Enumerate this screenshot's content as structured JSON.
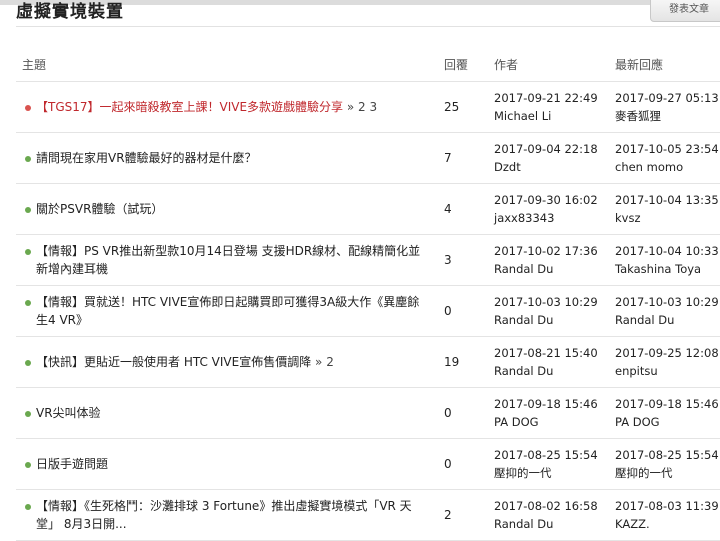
{
  "header": {
    "title": "虛擬實境裝置",
    "post_button": "發表文章"
  },
  "columns": {
    "topic": "主題",
    "replies": "回覆",
    "author": "作者",
    "last_reply": "最新回應"
  },
  "colors": {
    "hot_title": "#c0282d",
    "hot_dot": "#d9534f",
    "normal_dot": "#6aa84f"
  },
  "topics": [
    {
      "title": "【TGS17】一起來暗殺教室上課！VIVE多款遊戲體驗分享",
      "pages": "» 2 3",
      "hot": true,
      "replies": "25",
      "author_date": "2017-09-21 22:49",
      "author": "Michael Li",
      "last_date": "2017-09-27 05:13",
      "last_user": "麥香狐狸"
    },
    {
      "title": "請問現在家用VR體驗最好的器材是什麼？",
      "pages": "",
      "hot": false,
      "replies": "7",
      "author_date": "2017-09-04 22:18",
      "author": "Dzdt",
      "last_date": "2017-10-05 23:54",
      "last_user": "chen momo"
    },
    {
      "title": "關於PSVR體驗（試玩）",
      "pages": "",
      "hot": false,
      "replies": "4",
      "author_date": "2017-09-30 16:02",
      "author": "jaxx83343",
      "last_date": "2017-10-04 13:35",
      "last_user": "kvsz"
    },
    {
      "title": "【情報】PS VR推出新型款10月14日登場 支援HDR線材、配線精簡化並新增內建耳機",
      "pages": "",
      "hot": false,
      "replies": "3",
      "author_date": "2017-10-02 17:36",
      "author": "Randal Du",
      "last_date": "2017-10-04 10:33",
      "last_user": "Takashina Toya"
    },
    {
      "title": "【情報】買就送！HTC VIVE宣佈即日起購買即可獲得3A級大作《異塵餘生4 VR》",
      "pages": "",
      "hot": false,
      "replies": "0",
      "author_date": "2017-10-03 10:29",
      "author": "Randal Du",
      "last_date": "2017-10-03 10:29",
      "last_user": "Randal Du"
    },
    {
      "title": "【快訊】更貼近一般使用者 HTC VIVE宣佈售價調降",
      "pages": "» 2",
      "hot": false,
      "replies": "19",
      "author_date": "2017-08-21 15:40",
      "author": "Randal Du",
      "last_date": "2017-09-25 12:08",
      "last_user": "enpitsu"
    },
    {
      "title": "VR尖叫体验",
      "pages": "",
      "hot": false,
      "replies": "0",
      "author_date": "2017-09-18 15:46",
      "author": "PA DOG",
      "last_date": "2017-09-18 15:46",
      "last_user": "PA DOG"
    },
    {
      "title": "日版手遊問題",
      "pages": "",
      "hot": false,
      "replies": "0",
      "author_date": "2017-08-25 15:54",
      "author": "壓抑的一代",
      "last_date": "2017-08-25 15:54",
      "last_user": "壓抑的一代"
    },
    {
      "title": "【情報】《生死格鬥：沙灘排球 3 Fortune》推出虛擬實境模式「VR 天堂」 8月3日開...",
      "pages": "",
      "hot": false,
      "replies": "2",
      "author_date": "2017-08-02 16:58",
      "author": "Randal Du",
      "last_date": "2017-08-03 11:39",
      "last_user": "KAZZ."
    }
  ]
}
